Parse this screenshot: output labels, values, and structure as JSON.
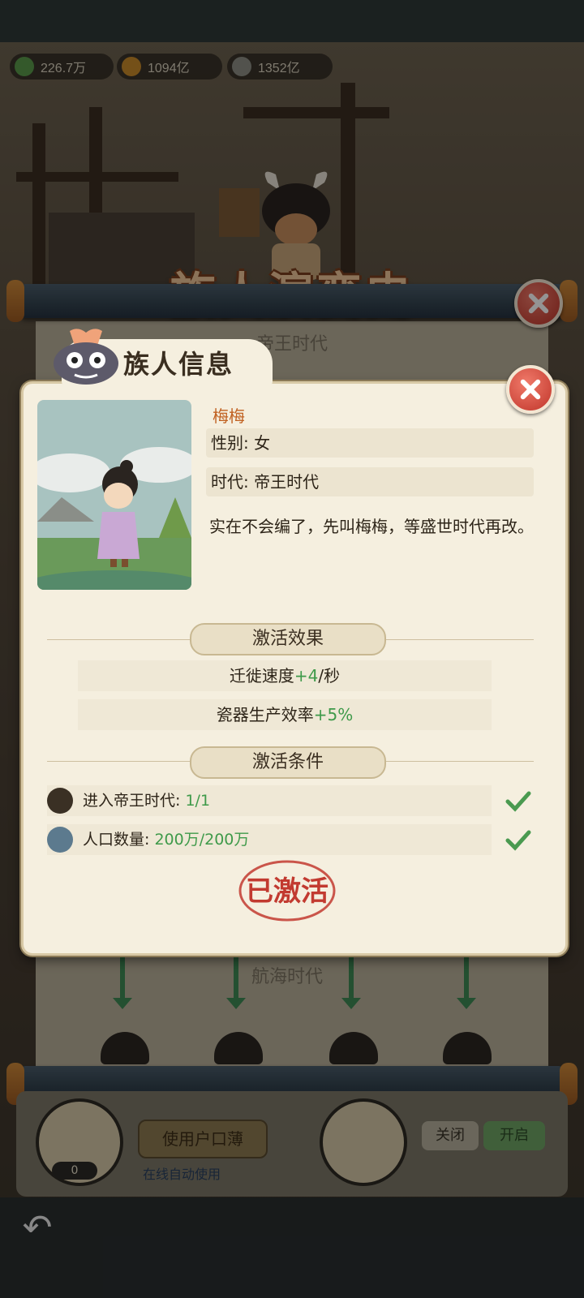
{
  "resources": [
    {
      "icon": "leaf-icon",
      "value": "226.7万"
    },
    {
      "icon": "fruit-icon",
      "value": "1094亿"
    },
    {
      "icon": "stone-icon",
      "value": "1352亿"
    }
  ],
  "background": {
    "title": "族人演变史",
    "era_top": "帝王时代",
    "era_bottom": "航海时代",
    "use_button": "使用户口薄",
    "auto_use": "在线自动使用",
    "count": "0",
    "toggle_off": "关闭",
    "toggle_on": "开启"
  },
  "dialog": {
    "title": "族人信息",
    "name": "梅梅",
    "gender": "性别: 女",
    "era": "时代: 帝王时代",
    "description": "实在不会编了，先叫梅梅，等盛世时代再改。",
    "effects_header": "激活效果",
    "effects": [
      {
        "label": "迁徙速度",
        "value": "+4",
        "suffix": "/秒"
      },
      {
        "label": "瓷器生产效率",
        "value": "+5%",
        "suffix": ""
      }
    ],
    "conditions_header": "激活条件",
    "conditions": [
      {
        "icon": "scale-icon",
        "label": "进入帝王时代: ",
        "value": "1/1"
      },
      {
        "icon": "person-icon",
        "label": "人口数量: ",
        "value": "200万/200万"
      }
    ],
    "stamp": "已激活"
  },
  "colors": {
    "accent_green": "#3f9a4a",
    "name_orange": "#c06020",
    "close_red": "#c0352a"
  }
}
